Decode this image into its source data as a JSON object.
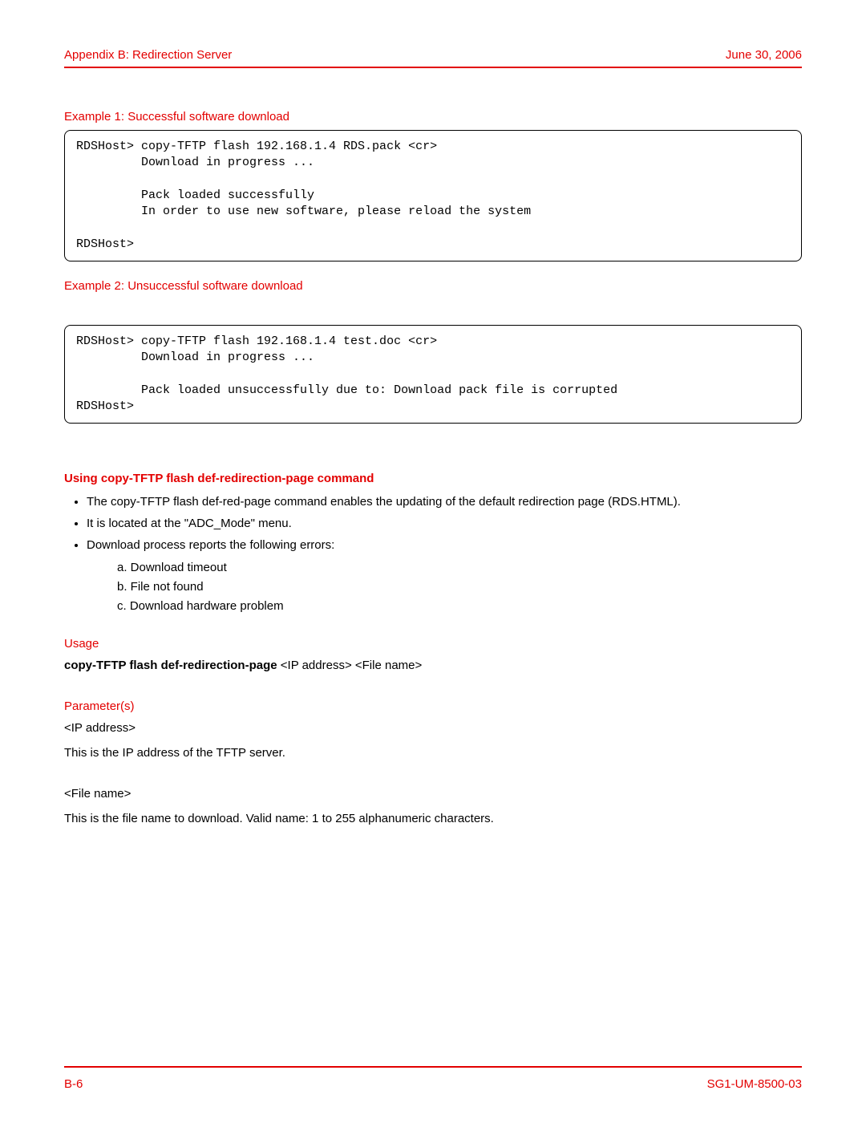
{
  "header": {
    "left": "Appendix B: Redirection Server",
    "right": "June 30, 2006"
  },
  "examples": {
    "ex1_title": "Example 1: Successful software download",
    "ex1_code": "RDSHost> copy-TFTP flash 192.168.1.4 RDS.pack <cr>\n         Download in progress ...\n\n         Pack loaded successfully\n         In order to use new software, please reload the system\n\nRDSHost>",
    "ex2_title": "Example 2: Unsuccessful software download",
    "ex2_code": "RDSHost> copy-TFTP flash 192.168.1.4 test.doc <cr>\n         Download in progress ...\n\n         Pack loaded unsuccessfully due to: Download pack file is corrupted\nRDSHost>"
  },
  "section": {
    "title": "Using copy-TFTP flash def-redirection-page command",
    "bullets": {
      "b1": "The copy-TFTP flash def-red-page command enables the updating of the default redirection page (RDS.HTML).",
      "b2": "It is located at the \"ADC_Mode\" menu.",
      "b3": "Download process reports the following errors:",
      "sub_a": "a. Download timeout",
      "sub_b": "b. File not found",
      "sub_c": "c. Download hardware problem"
    }
  },
  "usage": {
    "heading": "Usage",
    "cmd_bold": "copy-TFTP flash def-redirection-page",
    "cmd_rest": " <IP address> <File name>"
  },
  "params": {
    "heading": "Parameter(s)",
    "p1_name": "<IP address>",
    "p1_desc": "This is the IP address of the TFTP server.",
    "p2_name": "<File name>",
    "p2_desc": "This is the file name to download. Valid name: 1 to 255 alphanumeric characters."
  },
  "footer": {
    "left": "B-6",
    "right": "SG1-UM-8500-03"
  }
}
